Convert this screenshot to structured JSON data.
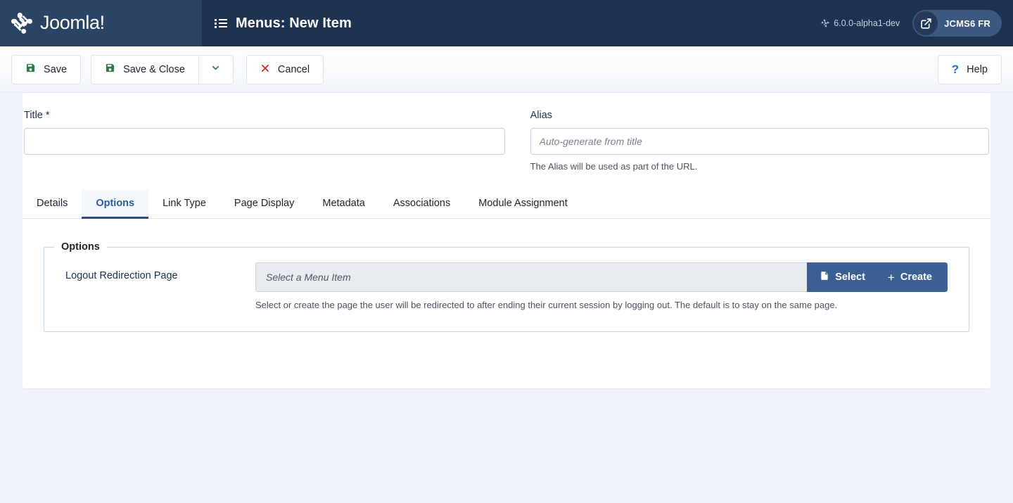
{
  "header": {
    "brand_name": "Joomla!",
    "brand_mark_icon": "joomla-logo-icon",
    "page_title": "Menus: New Item",
    "page_title_icon": "list-icon",
    "version": "6.0.0-alpha1-dev",
    "version_icon": "joomla-mini-icon",
    "site_link_label": "JCMS6 FR",
    "site_link_icon": "external-link-icon",
    "colors": {
      "header_bg": "#1f3350",
      "brand_bg": "#2a4466",
      "site_link_bg": "#3b597f"
    }
  },
  "toolbar": {
    "save_label": "Save",
    "save_icon": "floppy-disk-icon",
    "save_close_label": "Save & Close",
    "save_close_icon": "floppy-disk-icon",
    "dropdown_icon": "chevron-down-icon",
    "cancel_label": "Cancel",
    "cancel_icon": "close-x-icon",
    "help_label": "Help",
    "help_icon": "question-mark-icon",
    "colors": {
      "save_icon": "#2d7a46",
      "cancel_icon": "#d9252a",
      "help_icon": "#2a6ebb"
    }
  },
  "form": {
    "title": {
      "label": "Title *",
      "value": "",
      "placeholder": ""
    },
    "alias": {
      "label": "Alias",
      "value": "",
      "placeholder": "Auto-generate from title",
      "hint": "The Alias will be used as part of the URL."
    }
  },
  "tabs": [
    {
      "label": "Details",
      "active": false
    },
    {
      "label": "Options",
      "active": true
    },
    {
      "label": "Link Type",
      "active": false
    },
    {
      "label": "Page Display",
      "active": false
    },
    {
      "label": "Metadata",
      "active": false
    },
    {
      "label": "Associations",
      "active": false
    },
    {
      "label": "Module Assignment",
      "active": false
    }
  ],
  "options_panel": {
    "legend": "Options",
    "logout_redirect": {
      "label": "Logout Redirection Page",
      "value": "",
      "placeholder": "Select a Menu Item",
      "select_label": "Select",
      "select_icon": "file-document-icon",
      "create_label": "Create",
      "create_icon": "plus-icon",
      "hint": "Select or create the page the user will be redirected to after ending their current session by logging out. The default is to stay on the same page.",
      "button_color": "#3c6094"
    }
  }
}
